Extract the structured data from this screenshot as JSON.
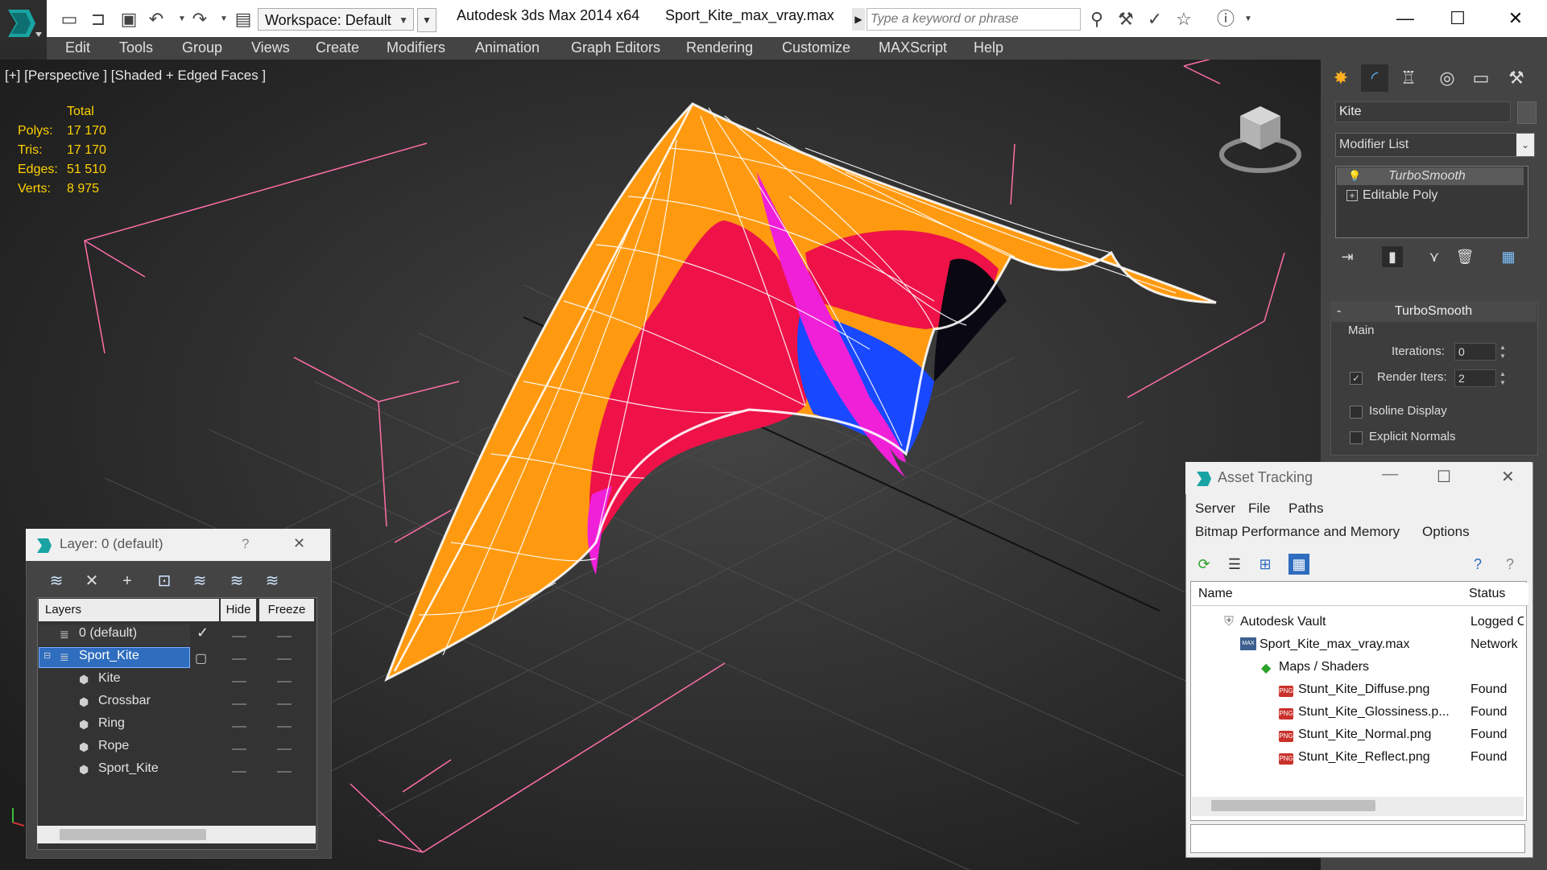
{
  "titlebar": {
    "workspace_label": "Workspace: Default",
    "app_title": "Autodesk 3ds Max  2014 x64",
    "file_title": "Sport_Kite_max_vray.max",
    "search_placeholder": "Type a keyword or phrase",
    "minimize": "—",
    "maximize": "☐",
    "close": "✕"
  },
  "menu": [
    "Edit",
    "Tools",
    "Group",
    "Views",
    "Create",
    "Modifiers",
    "Animation",
    "Graph Editors",
    "Rendering",
    "Customize",
    "MAXScript",
    "Help"
  ],
  "viewport": {
    "label": "[+] [Perspective ] [Shaded + Edged Faces ]",
    "stats_header": "Total",
    "stats": [
      {
        "label": "Polys:",
        "value": "17 170"
      },
      {
        "label": "Tris:",
        "value": "17 170"
      },
      {
        "label": "Edges:",
        "value": "51 510"
      },
      {
        "label": "Verts:",
        "value": "8 975"
      }
    ],
    "kite_colors": {
      "orange": "#ff9a10",
      "red": "#ee1248",
      "blue": "#1848ff",
      "magenta": "#f020d8",
      "black": "#0a0812",
      "grid": "#ff6ea8"
    }
  },
  "command_panel": {
    "object_name": "Kite",
    "modifier_list": "Modifier List",
    "stack": [
      "TurboSmooth",
      "Editable Poly"
    ],
    "rollout_title": "TurboSmooth",
    "group_main": "Main",
    "iterations_label": "Iterations:",
    "iterations_value": "0",
    "render_iters_label": "Render Iters:",
    "render_iters_value": "2",
    "isoline_label": "Isoline Display",
    "explicit_normals_label": "Explicit Normals"
  },
  "layer_dialog": {
    "title": "Layer: 0 (default)",
    "help": "?",
    "close": "✕",
    "col_layers": "Layers",
    "col_hide": "Hide",
    "col_freeze": "Freeze",
    "rows": [
      "0 (default)",
      "Sport_Kite",
      "Kite",
      "Crossbar",
      "Ring",
      "Rope",
      "Sport_Kite"
    ]
  },
  "asset_dialog": {
    "title": "Asset Tracking",
    "menu_row1": [
      "Server",
      "File",
      "Paths"
    ],
    "menu_row2": [
      "Bitmap Performance and Memory",
      "Options"
    ],
    "col_name": "Name",
    "col_status": "Status",
    "rows": [
      {
        "name": "Autodesk Vault",
        "status": "Logged O"
      },
      {
        "name": "Sport_Kite_max_vray.max",
        "status": "Network"
      },
      {
        "name": "Maps / Shaders",
        "status": ""
      },
      {
        "name": "Stunt_Kite_Diffuse.png",
        "status": "Found"
      },
      {
        "name": "Stunt_Kite_Glossiness.p...",
        "status": "Found"
      },
      {
        "name": "Stunt_Kite_Normal.png",
        "status": "Found"
      },
      {
        "name": "Stunt_Kite_Reflect.png",
        "status": "Found"
      }
    ]
  }
}
